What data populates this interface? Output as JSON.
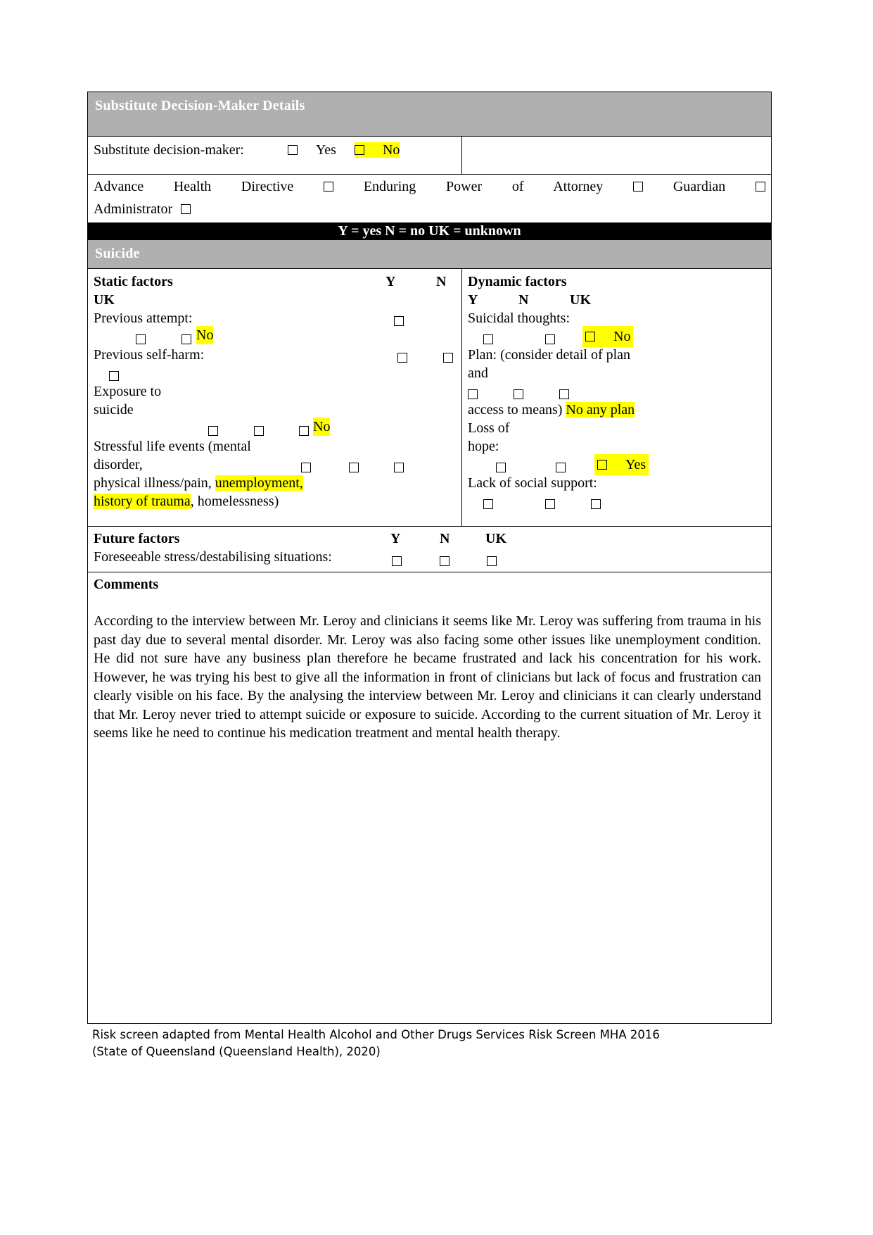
{
  "sections": {
    "substitute_header": "Substitute Decision-Maker Details",
    "legend_bar": "Y = yes N = no UK = unknown",
    "suicide_header": "Suicide"
  },
  "substitute_decision_maker": {
    "label": "Substitute decision-maker:",
    "yes_label": "Yes",
    "no_label": "No",
    "no_highlighted": true
  },
  "directives_row": {
    "advance_health_directive": "Advance  Health  Directive",
    "enduring_power_of_attorney": "Enduring  Power  of  Attorney",
    "guardian": "Guardian",
    "administrator": "Administrator"
  },
  "static_factors": {
    "heading": "Static factors",
    "col_y": "Y",
    "col_n": "N",
    "col_uk": "UK",
    "items": [
      {
        "label": "Previous attempt:",
        "answer": "No",
        "answer_highlighted": true
      },
      {
        "label": "Previous self-harm:",
        "answer": "",
        "answer_highlighted": false
      },
      {
        "label": "Exposure to",
        "label2": "suicide",
        "answer": "No",
        "answer_highlighted": true
      },
      {
        "label": "Stressful life events (mental",
        "label2": "disorder,",
        "label3": "physical illness/pain, ",
        "label3_hl": "unemployment,",
        "label4_hl": "history of trauma",
        "label4": ", homelessness)"
      }
    ]
  },
  "dynamic_factors": {
    "heading": "Dynamic factors",
    "col_y": "Y",
    "col_n": "N",
    "col_uk": "UK",
    "items": [
      {
        "label": "Suicidal thoughts:",
        "answer": "No",
        "answer_highlighted": true
      },
      {
        "label": "Plan: (consider detail of plan",
        "label2": "and",
        "label3": "access to means) ",
        "answer": "No any plan",
        "answer_highlighted": true
      },
      {
        "label": "Loss of",
        "label2": "hope:",
        "answer": "Yes",
        "answer_highlighted": true
      },
      {
        "label": "Lack of social support:",
        "answer": "",
        "answer_highlighted": false
      }
    ]
  },
  "future_factors": {
    "heading": "Future factors",
    "col_y": "Y",
    "col_n": "N",
    "col_uk": "UK",
    "item_label": "Foreseeable stress/destabilising situations:"
  },
  "comments": {
    "heading": "Comments",
    "body": "According to the interview between Mr. Leroy and clinicians it seems like Mr. Leroy was suffering from trauma in his past day due to several mental disorder. Mr. Leroy was also facing some other issues like unemployment condition. He did not sure have any business plan therefore he became frustrated and lack his concentration for his work. However, he was trying his best to give all the information in front of clinicians but lack of focus and frustration can clearly visible on his face. By the analysing the interview between Mr. Leroy and clinicians it can clearly understand that Mr. Leroy never tried to attempt suicide or exposure to suicide. According to the current situation of Mr. Leroy it seems like he need to continue his medication treatment and mental health therapy."
  },
  "footer": {
    "line1": "Risk screen adapted from Mental Health Alcohol and Other Drugs Services Risk Screen MHA 2016",
    "line2": "(State of Queensland (Queensland Health), 2020)"
  },
  "colors": {
    "section_bar": "#b0b0b0",
    "legend_bar": "#000000",
    "highlight": "#ffff00",
    "border": "#000000"
  }
}
